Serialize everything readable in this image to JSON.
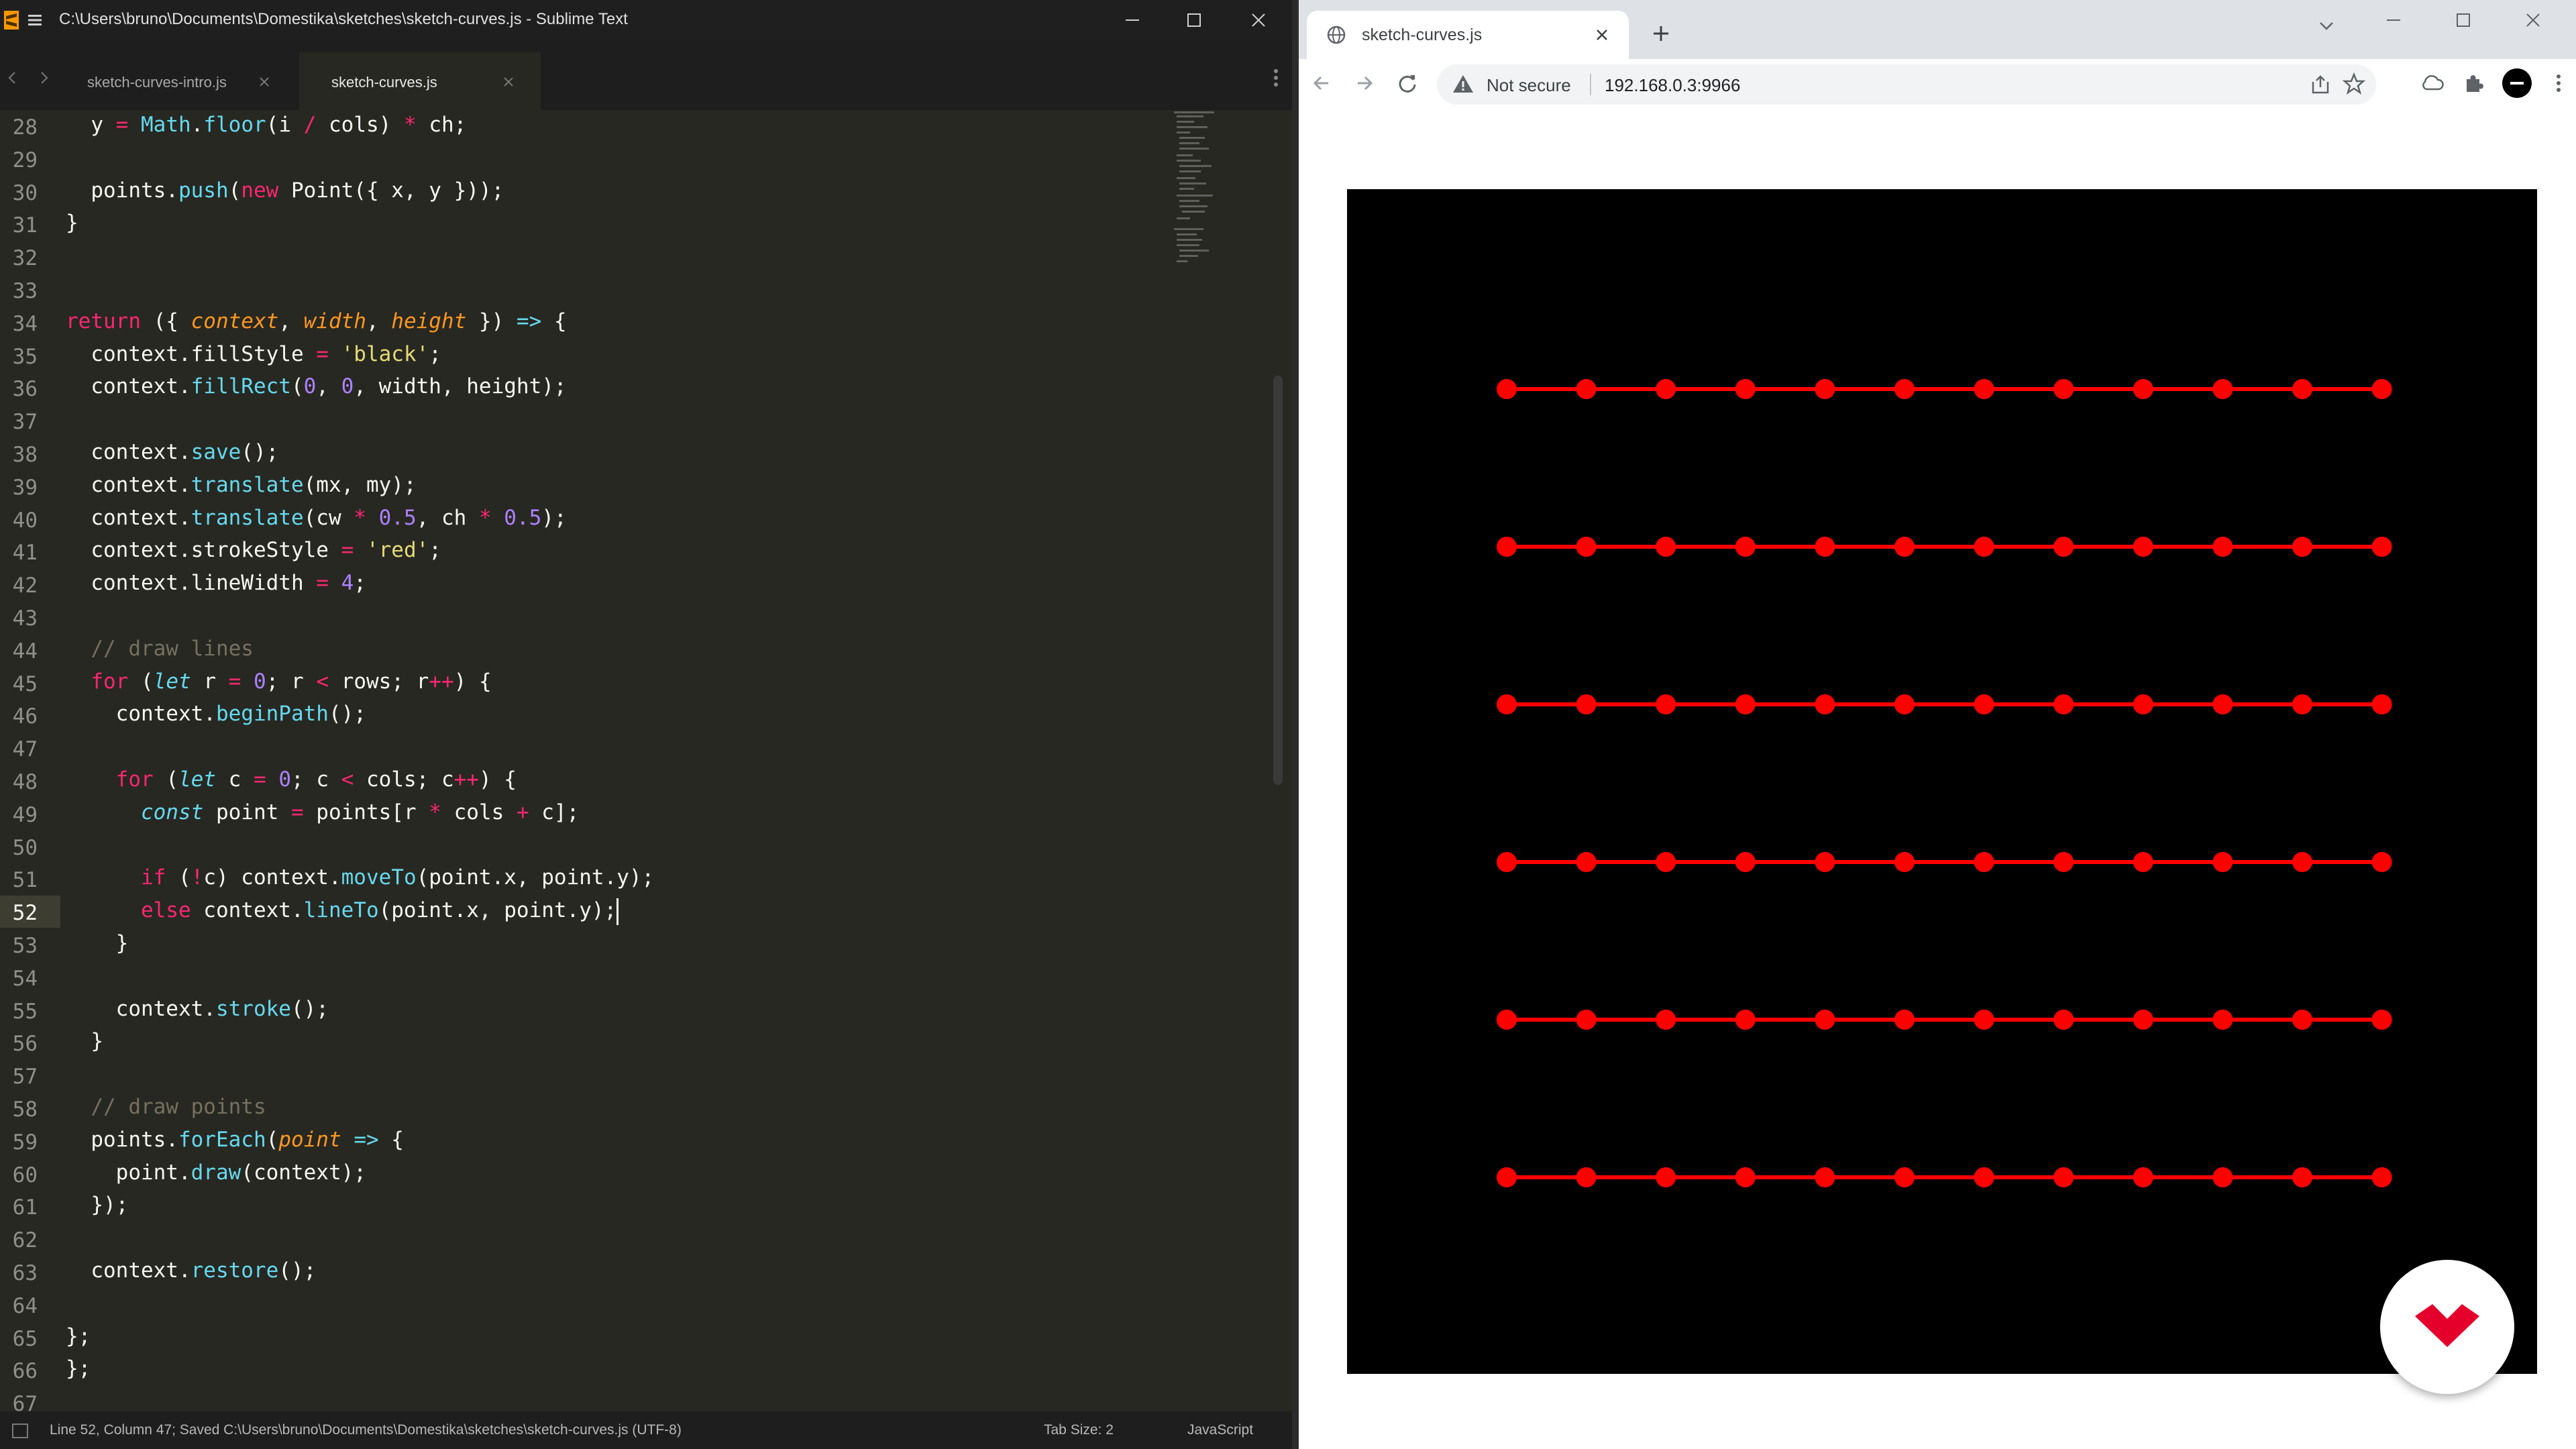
{
  "sublime": {
    "title": "C:\\Users\\bruno\\Documents\\Domestika\\sketches\\sketch-curves.js - Sublime Text",
    "tabs": [
      {
        "label": "sketch-curves-intro.js",
        "active": false
      },
      {
        "label": "sketch-curves.js",
        "active": true
      }
    ],
    "current_line": 52,
    "lines": [
      {
        "n": 28,
        "html": "  y <span class=\"op\">=</span> <span class=\"fn\">Math</span>.<span class=\"fn\">floor</span>(i <span class=\"op\">/</span> cols) <span class=\"op\">*</span> ch;"
      },
      {
        "n": 29,
        "html": ""
      },
      {
        "n": 30,
        "html": "  points.<span class=\"fn\">push</span>(<span class=\"kw\">new</span> Point({ x, y }));"
      },
      {
        "n": 31,
        "html": "}"
      },
      {
        "n": 32,
        "html": ""
      },
      {
        "n": 33,
        "html": ""
      },
      {
        "n": 34,
        "html": "<span class=\"kw\">return</span> ({ <span class=\"arg\">context</span>, <span class=\"arg\">width</span>, <span class=\"arg\">height</span> }) <span class=\"st\">=&gt;</span> {"
      },
      {
        "n": 35,
        "html": "  context.fillStyle <span class=\"op\">=</span> <span class=\"str\">'black'</span>;"
      },
      {
        "n": 36,
        "html": "  context.<span class=\"fn\">fillRect</span>(<span class=\"num\">0</span>, <span class=\"num\">0</span>, width, height);"
      },
      {
        "n": 37,
        "html": ""
      },
      {
        "n": 38,
        "html": "  context.<span class=\"fn\">save</span>();"
      },
      {
        "n": 39,
        "html": "  context.<span class=\"fn\">translate</span>(mx, my);"
      },
      {
        "n": 40,
        "html": "  context.<span class=\"fn\">translate</span>(cw <span class=\"op\">*</span> <span class=\"num\">0.5</span>, ch <span class=\"op\">*</span> <span class=\"num\">0.5</span>);"
      },
      {
        "n": 41,
        "html": "  context.strokeStyle <span class=\"op\">=</span> <span class=\"str\">'red'</span>;"
      },
      {
        "n": 42,
        "html": "  context.lineWidth <span class=\"op\">=</span> <span class=\"num\">4</span>;"
      },
      {
        "n": 43,
        "html": ""
      },
      {
        "n": 44,
        "html": "  <span class=\"cm\">// draw lines</span>"
      },
      {
        "n": 45,
        "html": "  <span class=\"kw\">for</span> (<span class=\"st\">let</span> r <span class=\"op\">=</span> <span class=\"num\">0</span>; r <span class=\"op\">&lt;</span> rows; r<span class=\"op\">++</span>) {"
      },
      {
        "n": 46,
        "html": "    context.<span class=\"fn\">beginPath</span>();"
      },
      {
        "n": 47,
        "html": ""
      },
      {
        "n": 48,
        "html": "    <span class=\"kw\">for</span> (<span class=\"st\">let</span> c <span class=\"op\">=</span> <span class=\"num\">0</span>; c <span class=\"op\">&lt;</span> cols; c<span class=\"op\">++</span>) {"
      },
      {
        "n": 49,
        "html": "      <span class=\"st\">const</span> point <span class=\"op\">=</span> points[r <span class=\"op\">*</span> cols <span class=\"op\">+</span> c];"
      },
      {
        "n": 50,
        "html": ""
      },
      {
        "n": 51,
        "html": "      <span class=\"kw\">if</span> (<span class=\"op\">!</span>c) context.<span class=\"fn\">moveTo</span>(point.x, point.y);"
      },
      {
        "n": 52,
        "html": "      <span class=\"kw\">else</span> context.<span class=\"fn\">lineTo</span>(point.x, point.y);<span class=\"cursor\"></span>"
      },
      {
        "n": 53,
        "html": "    }"
      },
      {
        "n": 54,
        "html": ""
      },
      {
        "n": 55,
        "html": "    context.<span class=\"fn\">stroke</span>();"
      },
      {
        "n": 56,
        "html": "  }"
      },
      {
        "n": 57,
        "html": ""
      },
      {
        "n": 58,
        "html": "  <span class=\"cm\">// draw points</span>"
      },
      {
        "n": 59,
        "html": "  points.<span class=\"fn\">forEach</span>(<span class=\"arg\">point</span> <span class=\"st\">=&gt;</span> {"
      },
      {
        "n": 60,
        "html": "    point.<span class=\"fn\">draw</span>(context);"
      },
      {
        "n": 61,
        "html": "  });"
      },
      {
        "n": 62,
        "html": ""
      },
      {
        "n": 63,
        "html": "  context.<span class=\"fn\">restore</span>();"
      },
      {
        "n": 64,
        "html": ""
      },
      {
        "n": 65,
        "html": "};"
      },
      {
        "n": 66,
        "html": "};"
      },
      {
        "n": 67,
        "html": ""
      }
    ],
    "status": {
      "message": "Line 52, Column 47; Saved C:\\Users\\bruno\\Documents\\Domestika\\sketches\\sketch-curves.js (UTF-8)",
      "tab_size": "Tab Size: 2",
      "syntax": "JavaScript"
    }
  },
  "chrome": {
    "tab_title": "sketch-curves.js",
    "security_label": "Not secure",
    "url": "192.168.0.3:9966",
    "sketch": {
      "background": "#000000",
      "stroke_color": "#ff0000",
      "rows": 6,
      "cols": 12
    }
  }
}
